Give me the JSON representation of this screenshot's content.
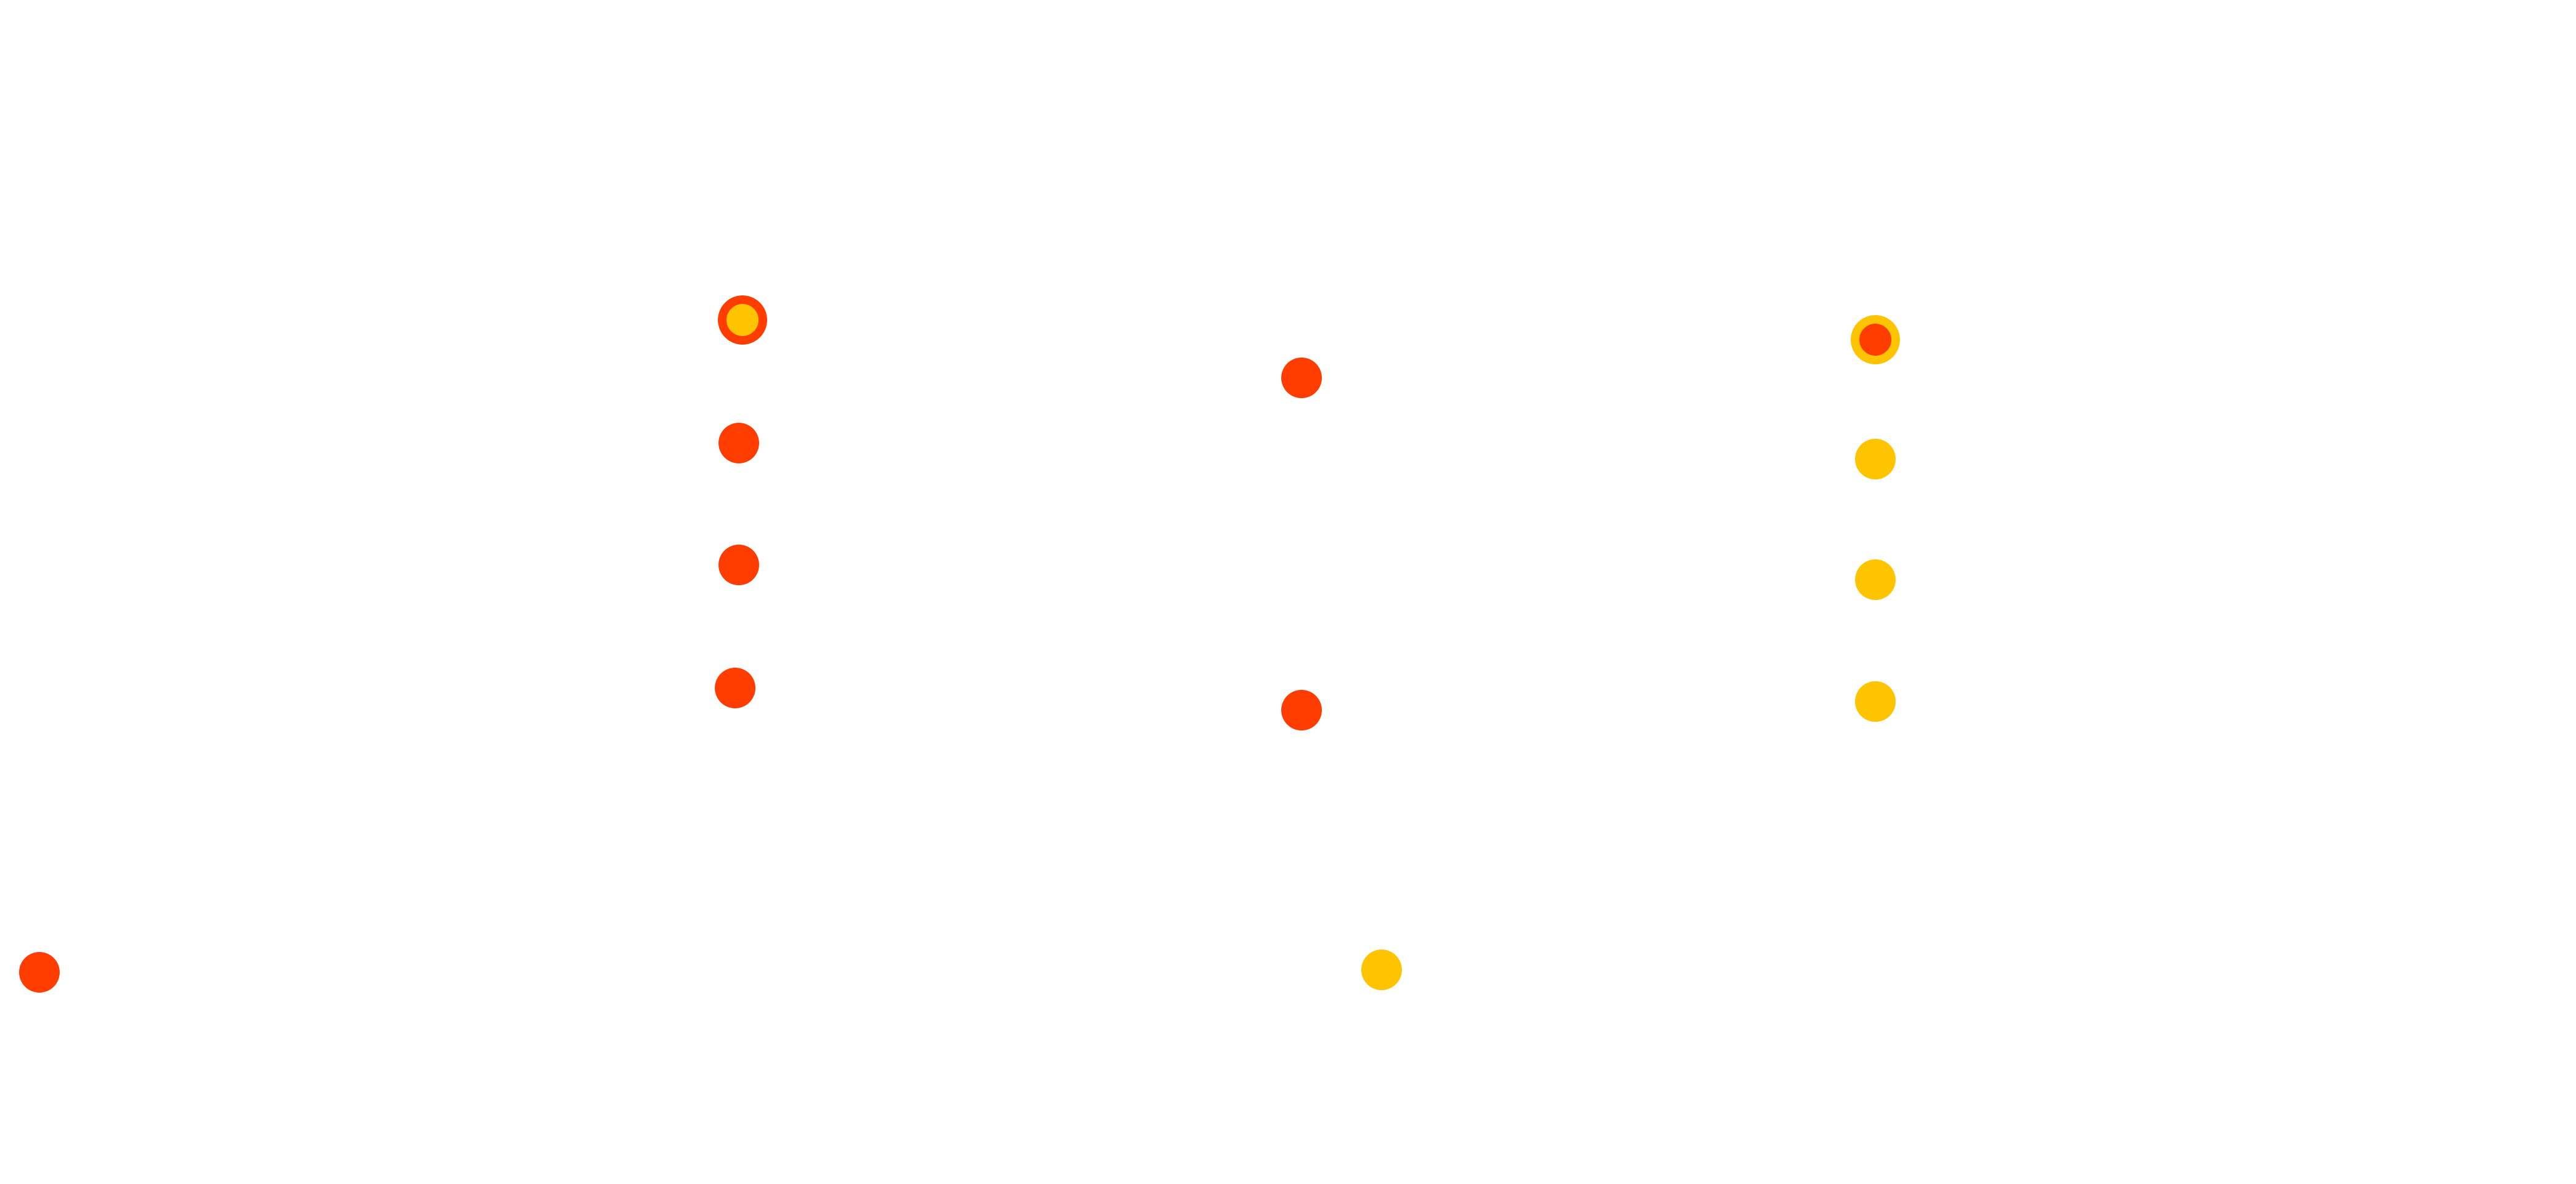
{
  "colors": {
    "background": "#ffffff",
    "red": "#ff3d00",
    "yellow": "#ffc400"
  },
  "dots": [
    {
      "id": "dot-1",
      "fill": "red",
      "ring": null
    },
    {
      "id": "dot-2",
      "fill": "yellow",
      "ring": "red"
    },
    {
      "id": "dot-3",
      "fill": "red",
      "ring": null
    },
    {
      "id": "dot-4",
      "fill": "red",
      "ring": null
    },
    {
      "id": "dot-5",
      "fill": "red",
      "ring": null
    },
    {
      "id": "dot-6",
      "fill": "red",
      "ring": null
    },
    {
      "id": "dot-7",
      "fill": "red",
      "ring": null
    },
    {
      "id": "dot-8",
      "fill": "yellow",
      "ring": null
    },
    {
      "id": "dot-9",
      "fill": "red",
      "ring": "yellow"
    },
    {
      "id": "dot-10",
      "fill": "yellow",
      "ring": null
    },
    {
      "id": "dot-11",
      "fill": "yellow",
      "ring": null
    },
    {
      "id": "dot-12",
      "fill": "yellow",
      "ring": null
    }
  ]
}
